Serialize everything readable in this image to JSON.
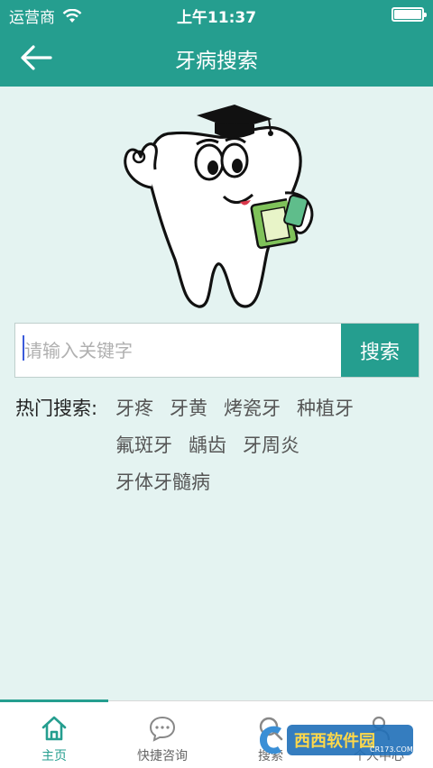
{
  "status_bar": {
    "carrier": "运营商",
    "time": "上午11:37"
  },
  "nav": {
    "title": "牙病搜索"
  },
  "search": {
    "placeholder": "请输入关键字",
    "value": "",
    "button_label": "搜索"
  },
  "hot_search": {
    "label": "热门搜索:",
    "rows": [
      [
        "牙疼",
        "牙黄",
        "烤瓷牙",
        "种植牙"
      ],
      [
        "氟斑牙",
        "龋齿",
        "牙周炎"
      ],
      [
        "牙体牙髓病"
      ]
    ]
  },
  "tabs": [
    {
      "label": "主页",
      "icon": "home-icon",
      "active": true
    },
    {
      "label": "快捷咨询",
      "icon": "chat-icon",
      "active": false
    },
    {
      "label": "搜索",
      "icon": "search-icon",
      "active": false
    },
    {
      "label": "个人中心",
      "icon": "user-icon",
      "active": false
    }
  ],
  "colors": {
    "primary": "#259e8f",
    "background": "#e4f3f1"
  },
  "watermark": {
    "brand": "西西软件园",
    "url": "CR173.COM"
  }
}
